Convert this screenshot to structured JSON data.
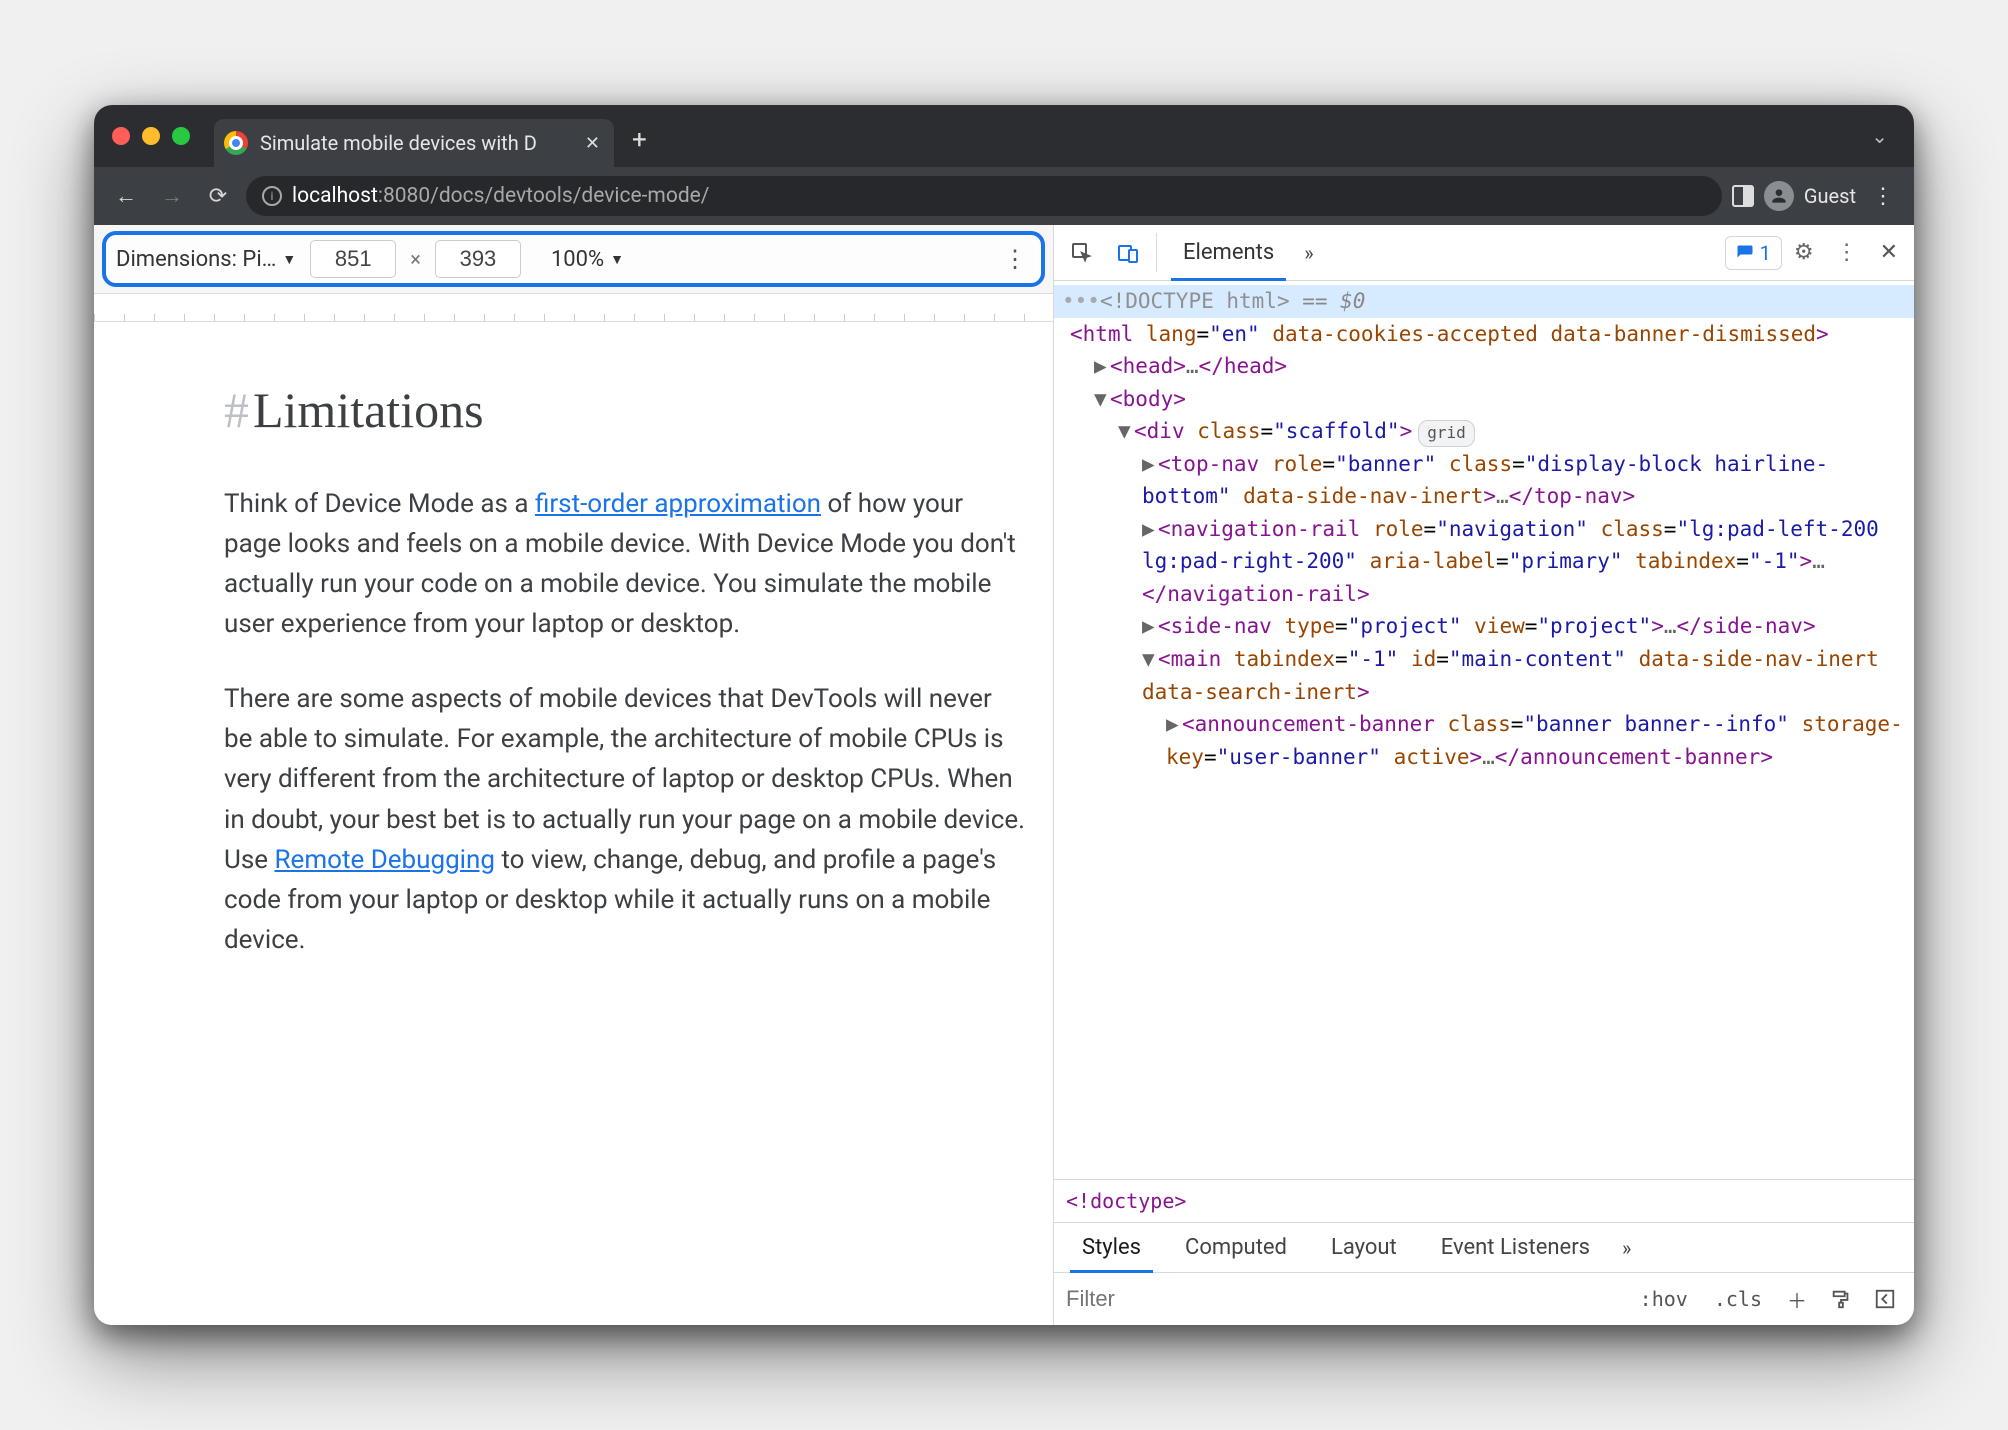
{
  "tab": {
    "title": "Simulate mobile devices with D"
  },
  "url": {
    "host": "localhost",
    "port": ":8080",
    "path": "/docs/devtools/device-mode/"
  },
  "guest_label": "Guest",
  "device_toolbar": {
    "dimensions_label": "Dimensions: Pi…",
    "width": "851",
    "height": "393",
    "multiply": "×",
    "zoom": "100%"
  },
  "page": {
    "heading_hash": "#",
    "heading": "Limitations",
    "p1_a": "Think of Device Mode as a ",
    "p1_link": "first-order approximation",
    "p1_b": " of how your page looks and feels on a mobile device. With Device Mode you don't actually run your code on a mobile device. You simulate the mobile user experience from your laptop or desktop.",
    "p2_a": "There are some aspects of mobile devices that DevTools will never be able to simulate. For example, the architecture of mobile CPUs is very different from the architecture of laptop or desktop CPUs. When in doubt, your best bet is to actually run your page on a mobile device. Use ",
    "p2_link": "Remote Debugging",
    "p2_b": " to view, change, debug, and profile a page's code from your laptop or desktop while it actually runs on a mobile device."
  },
  "devtools": {
    "tabs": {
      "elements": "Elements"
    },
    "issues_count": "1",
    "dom": {
      "doctype": "<!DOCTYPE html>",
      "eq0": " == $0",
      "html_open": "<html lang=\"en\" data-cookies-accepted data-banner-dismissed>",
      "head": "<head>…</head>",
      "body": "<body>",
      "div_scaffold": "<div class=\"scaffold\">",
      "grid_badge": "grid",
      "topnav": "<top-nav role=\"banner\" class=\"display-block hairline-bottom\" data-side-nav-inert>…</top-nav>",
      "navrail": "<navigation-rail role=\"navigation\" class=\"lg:pad-left-200 lg:pad-right-200\" aria-label=\"primary\" tabindex=\"-1\">…</navigation-rail>",
      "sidenav": "<side-nav type=\"project\" view=\"project\">…</side-nav>",
      "main": "<main tabindex=\"-1\" id=\"main-content\" data-side-nav-inert data-search-inert>",
      "announce": "<announcement-banner class=\"banner banner--info\" storage-key=\"user-banner\" active>…</announcement-banner>"
    },
    "breadcrumb": "<!doctype>",
    "sub_tabs": {
      "styles": "Styles",
      "computed": "Computed",
      "layout": "Layout",
      "events": "Event Listeners"
    },
    "styles_toolbar": {
      "filter_placeholder": "Filter",
      "hov": ":hov",
      "cls": ".cls"
    }
  }
}
